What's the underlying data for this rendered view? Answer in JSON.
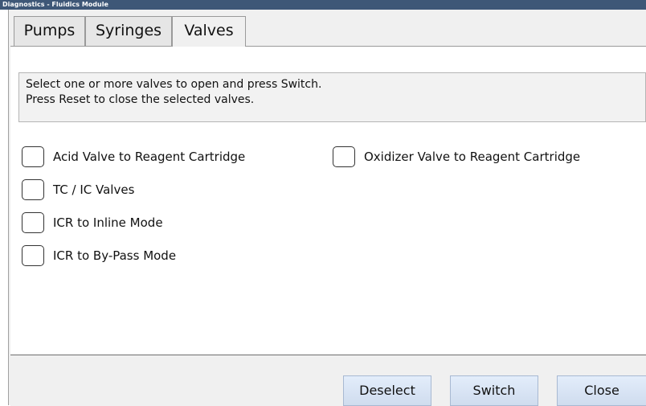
{
  "window": {
    "title": "Diagnostics - Fluidics Module"
  },
  "tabs": [
    {
      "label": "Pumps",
      "active": false
    },
    {
      "label": "Syringes",
      "active": false
    },
    {
      "label": "Valves",
      "active": true
    }
  ],
  "instructions": {
    "line1": "Select one or more valves to open and press Switch.",
    "line2": "Press Reset to close  the selected valves."
  },
  "valves": [
    {
      "label": "Acid Valve to Reagent Cartridge",
      "checked": false
    },
    {
      "label": "TC / IC Valves",
      "checked": false
    },
    {
      "label": "ICR to Inline Mode",
      "checked": false
    },
    {
      "label": "ICR to By-Pass Mode",
      "checked": false
    },
    {
      "label": "Oxidizer Valve to Reagent Cartridge",
      "checked": false
    }
  ],
  "buttons": {
    "deselect": "Deselect",
    "switch": "Switch",
    "close": "Close"
  }
}
